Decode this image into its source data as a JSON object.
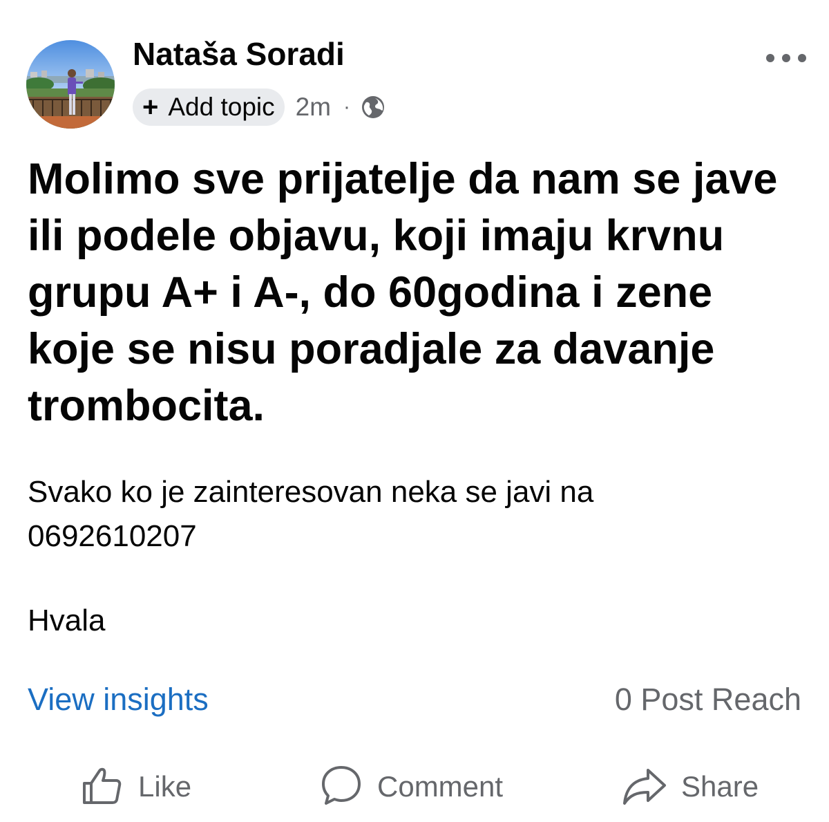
{
  "post": {
    "author_name": "Nataša Soradi",
    "avatar_icon": "profile-photo",
    "topic_label": "Add topic",
    "topic_icon": "plus-icon",
    "timestamp": "2m",
    "separator": "·",
    "audience_icon": "globe-icon",
    "more_icon": "more-horizontal-icon",
    "headline": "Molimo sve prijatelje da nam se jave ili podele objavu, koji imaju krvnu grupu A+ i A-, do 60godina i zene koje se nisu poradjale za davanje trombocita.",
    "body": "Svako ko je zainteresovan neka se javi na\n0692610207",
    "thanks": "Hvala"
  },
  "insights": {
    "view_label": "View insights",
    "reach_label": "0 Post Reach"
  },
  "actions": {
    "like_label": "Like",
    "like_icon": "thumbs-up-icon",
    "comment_label": "Comment",
    "comment_icon": "comment-icon",
    "share_label": "Share",
    "share_icon": "share-icon"
  },
  "colors": {
    "link": "#1b6ec2",
    "secondary_text": "#65676b",
    "pill_background": "#e9ebee",
    "primary_text": "#050505"
  }
}
